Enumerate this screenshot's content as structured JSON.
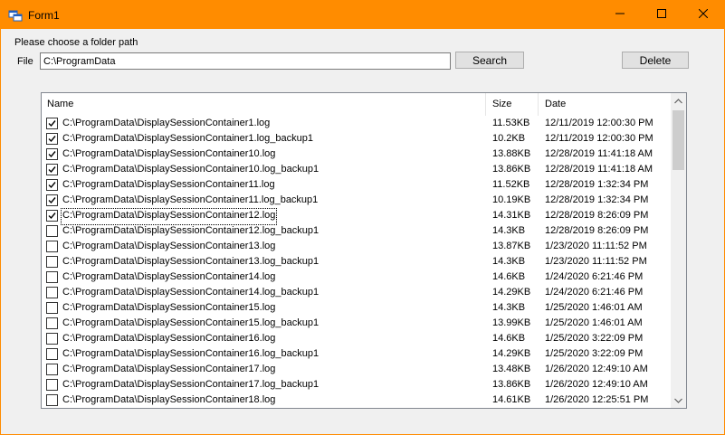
{
  "window": {
    "title": "Form1"
  },
  "form": {
    "prompt_label": "Please choose a folder path",
    "file_label": "File",
    "path_value": "C:\\ProgramData",
    "search_label": "Search",
    "delete_label": "Delete"
  },
  "list": {
    "columns": {
      "name": "Name",
      "size": "Size",
      "date": "Date"
    },
    "rows": [
      {
        "name": "C:\\ProgramData\\DisplaySessionContainer1.log",
        "size": "11.53KB",
        "date": "12/11/2019 12:00:30 PM",
        "checked": true
      },
      {
        "name": "C:\\ProgramData\\DisplaySessionContainer1.log_backup1",
        "size": "10.2KB",
        "date": "12/11/2019 12:00:30 PM",
        "checked": true
      },
      {
        "name": "C:\\ProgramData\\DisplaySessionContainer10.log",
        "size": "13.88KB",
        "date": "12/28/2019 11:41:18 AM",
        "checked": true
      },
      {
        "name": "C:\\ProgramData\\DisplaySessionContainer10.log_backup1",
        "size": "13.86KB",
        "date": "12/28/2019 11:41:18 AM",
        "checked": true
      },
      {
        "name": "C:\\ProgramData\\DisplaySessionContainer11.log",
        "size": "11.52KB",
        "date": "12/28/2019 1:32:34 PM",
        "checked": true
      },
      {
        "name": "C:\\ProgramData\\DisplaySessionContainer11.log_backup1",
        "size": "10.19KB",
        "date": "12/28/2019 1:32:34 PM",
        "checked": true
      },
      {
        "name": "C:\\ProgramData\\DisplaySessionContainer12.log",
        "size": "14.31KB",
        "date": "12/28/2019 8:26:09 PM",
        "checked": true,
        "focused": true
      },
      {
        "name": "C:\\ProgramData\\DisplaySessionContainer12.log_backup1",
        "size": "14.3KB",
        "date": "12/28/2019 8:26:09 PM",
        "checked": false
      },
      {
        "name": "C:\\ProgramData\\DisplaySessionContainer13.log",
        "size": "13.87KB",
        "date": "1/23/2020 11:11:52 PM",
        "checked": false
      },
      {
        "name": "C:\\ProgramData\\DisplaySessionContainer13.log_backup1",
        "size": "14.3KB",
        "date": "1/23/2020 11:11:52 PM",
        "checked": false
      },
      {
        "name": "C:\\ProgramData\\DisplaySessionContainer14.log",
        "size": "14.6KB",
        "date": "1/24/2020 6:21:46 PM",
        "checked": false
      },
      {
        "name": "C:\\ProgramData\\DisplaySessionContainer14.log_backup1",
        "size": "14.29KB",
        "date": "1/24/2020 6:21:46 PM",
        "checked": false
      },
      {
        "name": "C:\\ProgramData\\DisplaySessionContainer15.log",
        "size": "14.3KB",
        "date": "1/25/2020 1:46:01 AM",
        "checked": false
      },
      {
        "name": "C:\\ProgramData\\DisplaySessionContainer15.log_backup1",
        "size": "13.99KB",
        "date": "1/25/2020 1:46:01 AM",
        "checked": false
      },
      {
        "name": "C:\\ProgramData\\DisplaySessionContainer16.log",
        "size": "14.6KB",
        "date": "1/25/2020 3:22:09 PM",
        "checked": false
      },
      {
        "name": "C:\\ProgramData\\DisplaySessionContainer16.log_backup1",
        "size": "14.29KB",
        "date": "1/25/2020 3:22:09 PM",
        "checked": false
      },
      {
        "name": "C:\\ProgramData\\DisplaySessionContainer17.log",
        "size": "13.48KB",
        "date": "1/26/2020 12:49:10 AM",
        "checked": false
      },
      {
        "name": "C:\\ProgramData\\DisplaySessionContainer17.log_backup1",
        "size": "13.86KB",
        "date": "1/26/2020 12:49:10 AM",
        "checked": false
      },
      {
        "name": "C:\\ProgramData\\DisplaySessionContainer18.log",
        "size": "14.61KB",
        "date": "1/26/2020 12:25:51 PM",
        "checked": false
      }
    ]
  },
  "icons": {
    "app": "app-window-icon",
    "minimize": "minimize-icon",
    "maximize": "maximize-icon",
    "close": "close-icon",
    "checkmark": "checkmark-icon",
    "scroll_up": "chevron-up-icon",
    "scroll_down": "chevron-down-icon"
  },
  "colors": {
    "titlebar": "#ff8c00",
    "window_bg": "#f0f0f0"
  }
}
